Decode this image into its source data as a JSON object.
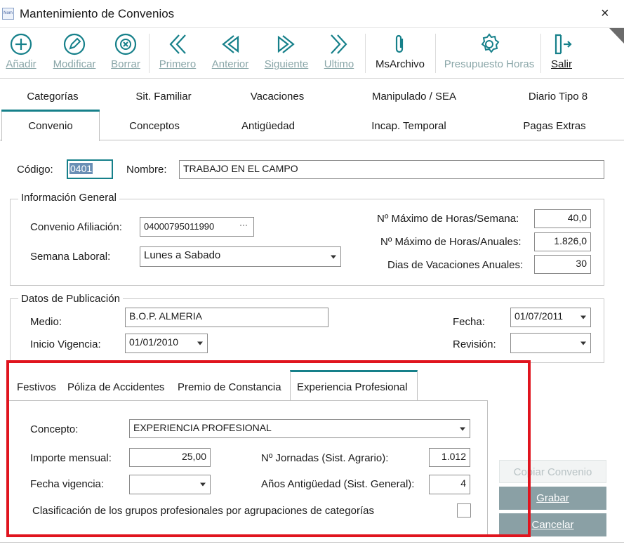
{
  "window": {
    "app_icon_text": "Nom",
    "title": "Mantenimiento de Convenios",
    "close": "×"
  },
  "toolbar": {
    "add": "Añadir",
    "edit": "Modificar",
    "delete": "Borrar",
    "first": "Primero",
    "prev": "Anterior",
    "next": "Siguiente",
    "last": "Ultimo",
    "msarchivo": "MsArchivo",
    "budget_hours": "Presupuesto Horas",
    "exit": "Salir"
  },
  "tabs": {
    "row1": [
      "Categorías",
      "Sit. Familiar",
      "Vacaciones",
      "Manipulado / SEA",
      "Diario Tipo 8"
    ],
    "row2": [
      "Convenio",
      "Conceptos",
      "Antigüedad",
      "Incap. Temporal",
      "Pagas Extras"
    ]
  },
  "header": {
    "codigo_label": "Código:",
    "codigo_value": "0401",
    "nombre_label": "Nombre:",
    "nombre_value": "TRABAJO EN EL CAMPO"
  },
  "info_general": {
    "title": "Información General",
    "convenio_afiliacion_label": "Convenio Afiliación:",
    "convenio_afiliacion_value": "04000795011990",
    "ellipsis": "···",
    "semana_laboral_label": "Semana Laboral:",
    "semana_laboral_value": "Lunes a Sabado",
    "max_horas_semana_label": "Nº Máximo de Horas/Semana:",
    "max_horas_semana_value": "40,0",
    "max_horas_anuales_label": "Nº Máximo de Horas/Anuales:",
    "max_horas_anuales_value": "1.826,0",
    "dias_vacaciones_label": "Dias de Vacaciones Anuales:",
    "dias_vacaciones_value": "30"
  },
  "publicacion": {
    "title": "Datos de Publicación",
    "medio_label": "Medio:",
    "medio_value": "B.O.P. ALMERIA",
    "inicio_label": "Inicio Vigencia:",
    "inicio_value": "01/01/2010",
    "fecha_label": "Fecha:",
    "fecha_value": "01/07/2011",
    "revision_label": "Revisión:",
    "revision_value": ""
  },
  "lower_tabs": [
    "Festivos",
    "Póliza de Accidentes",
    "Premio de Constancia",
    "Experiencia Profesional"
  ],
  "experiencia": {
    "concepto_label": "Concepto:",
    "concepto_value": "EXPERIENCIA PROFESIONAL",
    "importe_label": "Importe mensual:",
    "importe_value": "25,00",
    "fecha_vigencia_label": "Fecha vigencia:",
    "fecha_vigencia_value": "",
    "jornadas_label": "Nº Jornadas (Sist. Agrario):",
    "jornadas_value": "1.012",
    "anios_label": "Años Antigüedad (Sist. General):",
    "anios_value": "4",
    "clasificacion_label": "Clasificación de los grupos profesionales por agrupaciones de categorías"
  },
  "side_buttons": {
    "copiar": "Copiar Convenio",
    "grabar": "Grabar",
    "cancelar": "Cancelar"
  },
  "colors": {
    "accent_teal": "#16808a",
    "highlight_red": "#e0141e",
    "disabled_icon": "#8aa6a8",
    "button_gray": "#8aa0a5"
  }
}
